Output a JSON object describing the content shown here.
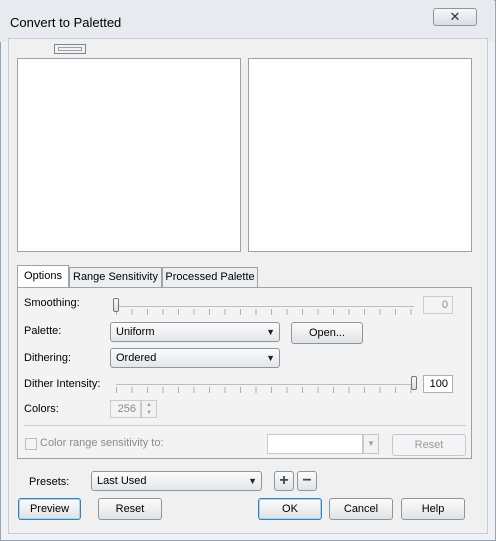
{
  "window": {
    "title": "Convert to Paletted",
    "close_glyph": "✕"
  },
  "tabs": [
    {
      "label": "Options",
      "active": true
    },
    {
      "label": "Range Sensitivity",
      "active": false
    },
    {
      "label": "Processed Palette",
      "active": false
    }
  ],
  "options": {
    "smoothing": {
      "label": "Smoothing:",
      "value": "0",
      "level": 0.0
    },
    "palette": {
      "label": "Palette:",
      "selected": "Uniform",
      "open_button": "Open..."
    },
    "dithering": {
      "label": "Dithering:",
      "selected": "Ordered"
    },
    "dither_intensity": {
      "label": "Dither Intensity:",
      "value": "100",
      "level": 1.0
    },
    "colors": {
      "label": "Colors:",
      "value": "256",
      "enabled": false
    },
    "color_range": {
      "label": "Color range sensitivity to:",
      "checked": false,
      "enabled": false,
      "reset_label": "Reset"
    }
  },
  "presets": {
    "label": "Presets:",
    "selected": "Last Used",
    "add_glyph": "+",
    "remove_glyph": "−"
  },
  "footer": {
    "preview": "Preview",
    "reset": "Reset",
    "ok": "OK",
    "cancel": "Cancel",
    "help": "Help"
  },
  "icons": {
    "dropdown": "chevron-down-icon",
    "add": "plus-icon",
    "remove": "minus-icon",
    "close": "close-icon"
  }
}
